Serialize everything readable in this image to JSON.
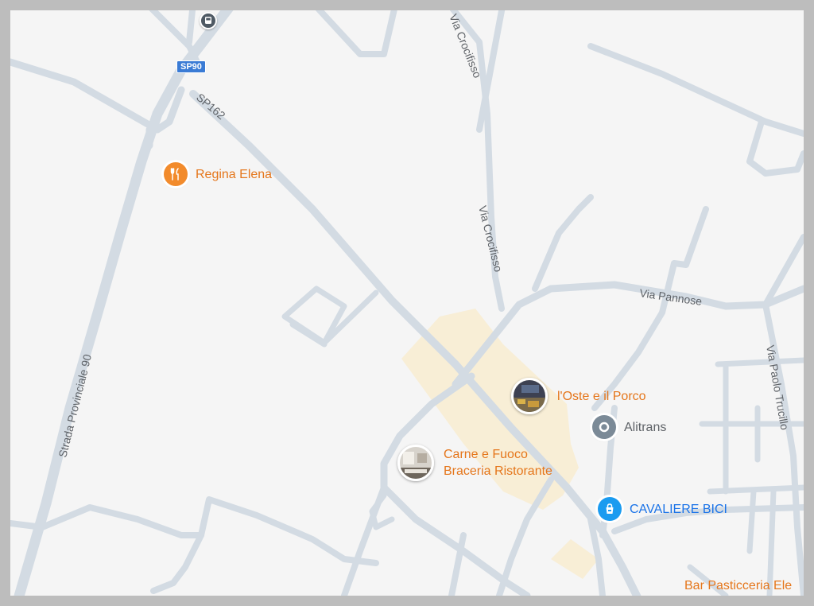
{
  "map": {
    "road_labels": {
      "sp162": "SP162",
      "strada_provinciale_90": "Strada Provinciale 90",
      "via_crocifisso_top": "Via Crocifisso",
      "via_crocifisso_mid": "Via Crocifisso",
      "via_pannose": "Via Pannose",
      "via_paolo_trucillo": "Via Paolo Trucillo"
    },
    "route_shield": "SP90",
    "transit_icon": "bus-stop-icon",
    "pois": {
      "regina_elena": {
        "name": "Regina Elena",
        "icon": "restaurant-icon",
        "color": "#e5761b"
      },
      "oste_porco": {
        "name": "l'Oste e il Porco",
        "icon": "photo-thumbnail",
        "color": "#e5761b"
      },
      "alitrans": {
        "name": "Alitrans",
        "icon": "location-pin-icon",
        "color": "#5f6368"
      },
      "carne_fuoco": {
        "line1": "Carne e Fuoco",
        "line2": "Braceria Ristorante",
        "icon": "photo-thumbnail",
        "color": "#e5761b"
      },
      "cavaliere_bici": {
        "name": "CAVALIERE BICI",
        "icon": "shopping-bag-icon",
        "color": "#1a73e8"
      },
      "bar_pasticceria": {
        "name": "Bar Pasticceria Ele",
        "color": "#e5761b"
      }
    },
    "colors": {
      "background": "#f5f5f5",
      "road": "#d3dbe3",
      "highlight_area": "#f8eed6"
    }
  }
}
